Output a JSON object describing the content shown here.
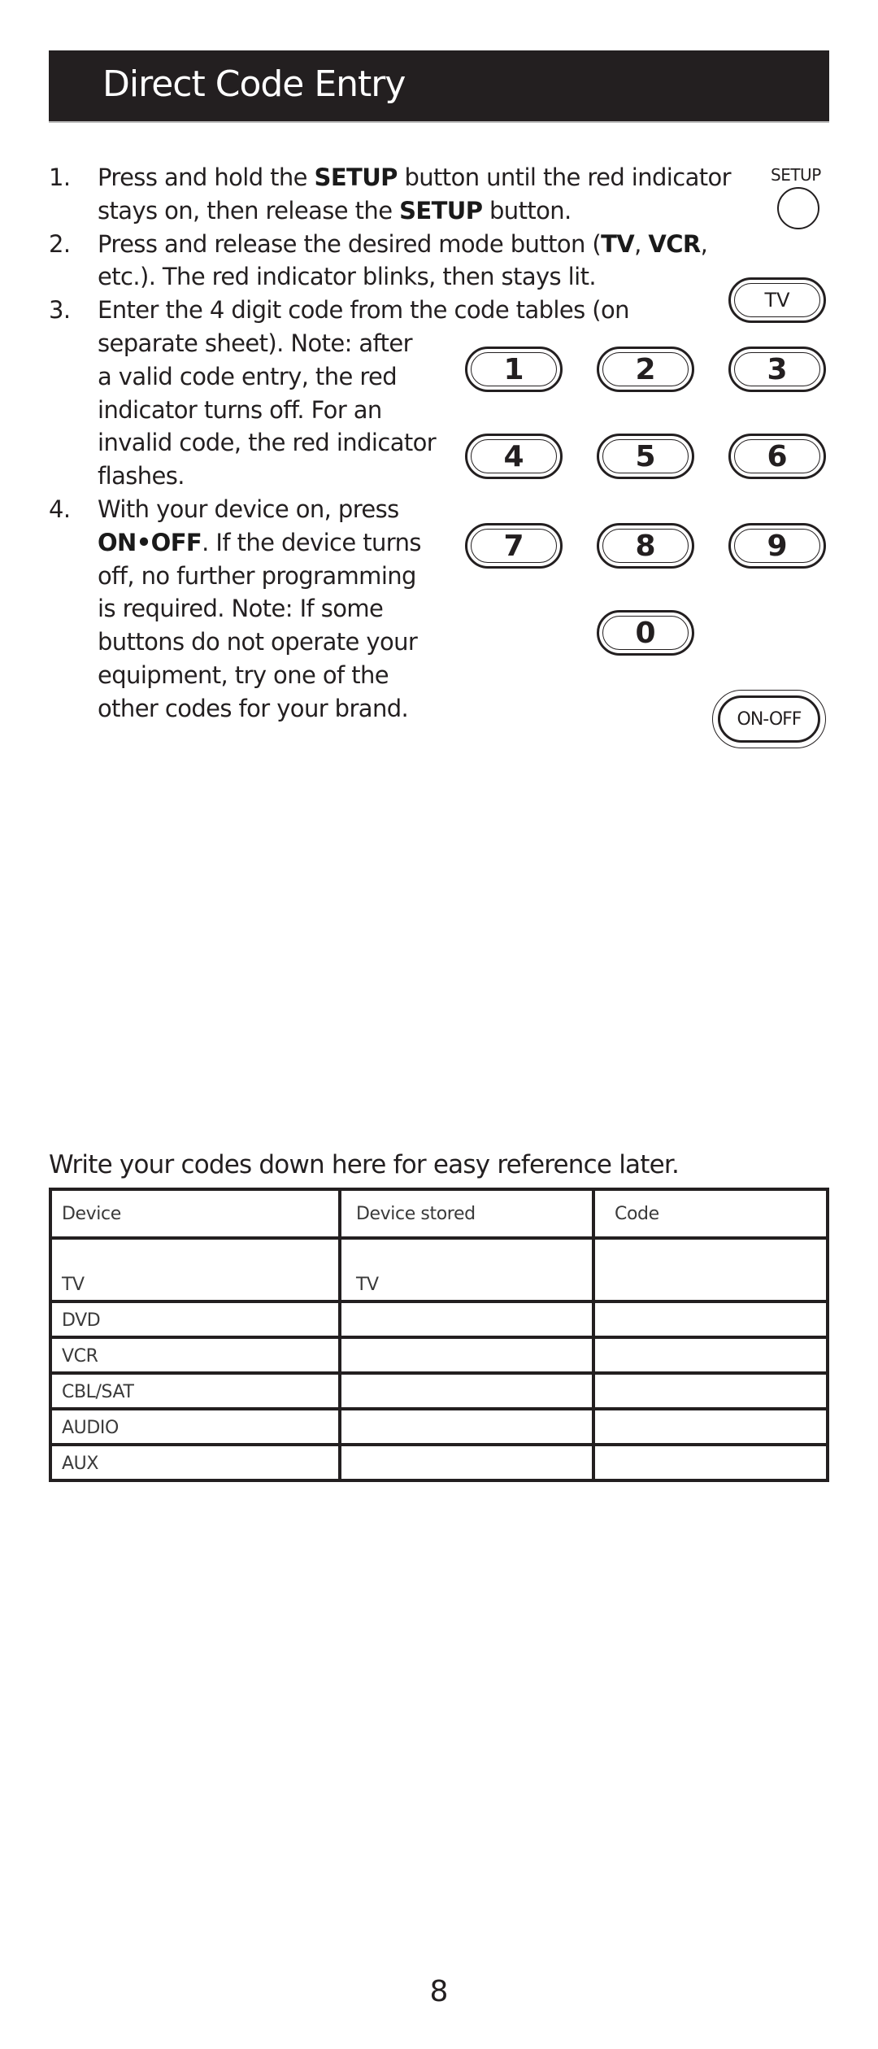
{
  "header": {
    "title": "Direct Code Entry"
  },
  "steps": [
    {
      "number": "1.",
      "lines": [
        [
          "Press and hold the ",
          {
            "b": "SETUP"
          },
          " button until the red indicator"
        ],
        [
          "stays on, then release the ",
          {
            "b": "SETUP"
          },
          " button."
        ]
      ]
    },
    {
      "number": "2.",
      "lines": [
        [
          "Press and release the desired mode button (",
          {
            "b": "TV"
          },
          ", ",
          {
            "b": "VCR"
          },
          ","
        ],
        [
          "etc.). The red indicator blinks, then stays lit."
        ]
      ]
    },
    {
      "number": "3.",
      "lines": [
        [
          "Enter the 4 digit code from the code tables (on"
        ],
        [
          "separate sheet). Note: after"
        ],
        [
          "a valid code entry, the red"
        ],
        [
          "indicator turns off.  For an"
        ],
        [
          "invalid code, the red indicator"
        ],
        [
          "flashes."
        ]
      ]
    },
    {
      "number": "4.",
      "lines": [
        [
          "With your device on, press"
        ],
        [
          {
            "b": "ON•OFF"
          },
          ". If the device turns"
        ],
        [
          "off, no further programming"
        ],
        [
          "is required. Note: If some"
        ],
        [
          "buttons do not operate your"
        ],
        [
          "equipment, try one of the"
        ],
        [
          "other codes for your brand."
        ]
      ]
    }
  ],
  "remote": {
    "setup_label": "SETUP",
    "tv_label": "TV",
    "keys": [
      "1",
      "2",
      "3",
      "4",
      "5",
      "6",
      "7",
      "8",
      "9",
      "0"
    ],
    "onoff_label": "ON-OFF"
  },
  "codes_note": "Write your codes down here for easy reference later.",
  "codes_table": {
    "headers": [
      "Device",
      "Device stored",
      "Code"
    ],
    "rows": [
      [
        "TV",
        "TV",
        ""
      ],
      [
        "DVD",
        "",
        ""
      ],
      [
        "VCR",
        "",
        ""
      ],
      [
        "CBL/SAT",
        "",
        ""
      ],
      [
        "AUDIO",
        "",
        ""
      ],
      [
        "AUX",
        "",
        ""
      ]
    ]
  },
  "page_number": "8"
}
